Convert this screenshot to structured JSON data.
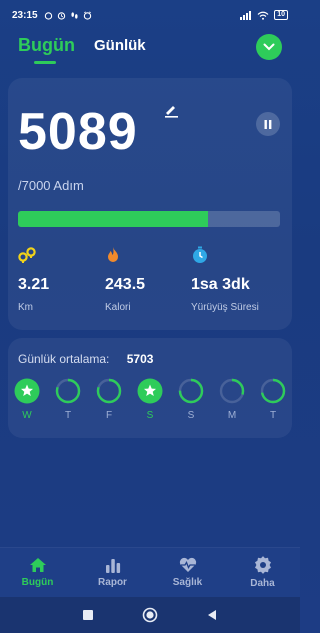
{
  "status_bar": {
    "time": "23:15",
    "battery": "10"
  },
  "tabs": {
    "today": "Bugün",
    "daily": "Günlük"
  },
  "steps": {
    "count": "5089",
    "goal": "/7000 Adım",
    "progress": 0.727
  },
  "stats": [
    {
      "value": "3.21",
      "label": "Km",
      "icon": "distance-icon"
    },
    {
      "value": "243.5",
      "label": "Kalori",
      "icon": "flame-icon"
    },
    {
      "value": "1sa 3dk",
      "label": "Yürüyüş Süresi",
      "icon": "timer-icon"
    }
  ],
  "weekly": {
    "avg_label": "Günlük ortalama:",
    "avg_value": "5703",
    "days": [
      {
        "letter": "W",
        "done": true,
        "fraction": 1.0
      },
      {
        "letter": "T",
        "done": false,
        "fraction": 0.8
      },
      {
        "letter": "F",
        "done": false,
        "fraction": 0.8
      },
      {
        "letter": "S",
        "done": true,
        "fraction": 1.0
      },
      {
        "letter": "S",
        "done": false,
        "fraction": 0.75
      },
      {
        "letter": "M",
        "done": false,
        "fraction": 0.3
      },
      {
        "letter": "T",
        "done": false,
        "fraction": 0.72
      }
    ]
  },
  "nav": {
    "home": "Bugün",
    "report": "Rapor",
    "health": "Sağlık",
    "more": "Daha"
  },
  "colors": {
    "accent": "#2ecc5a",
    "background": "#1b3f86"
  }
}
